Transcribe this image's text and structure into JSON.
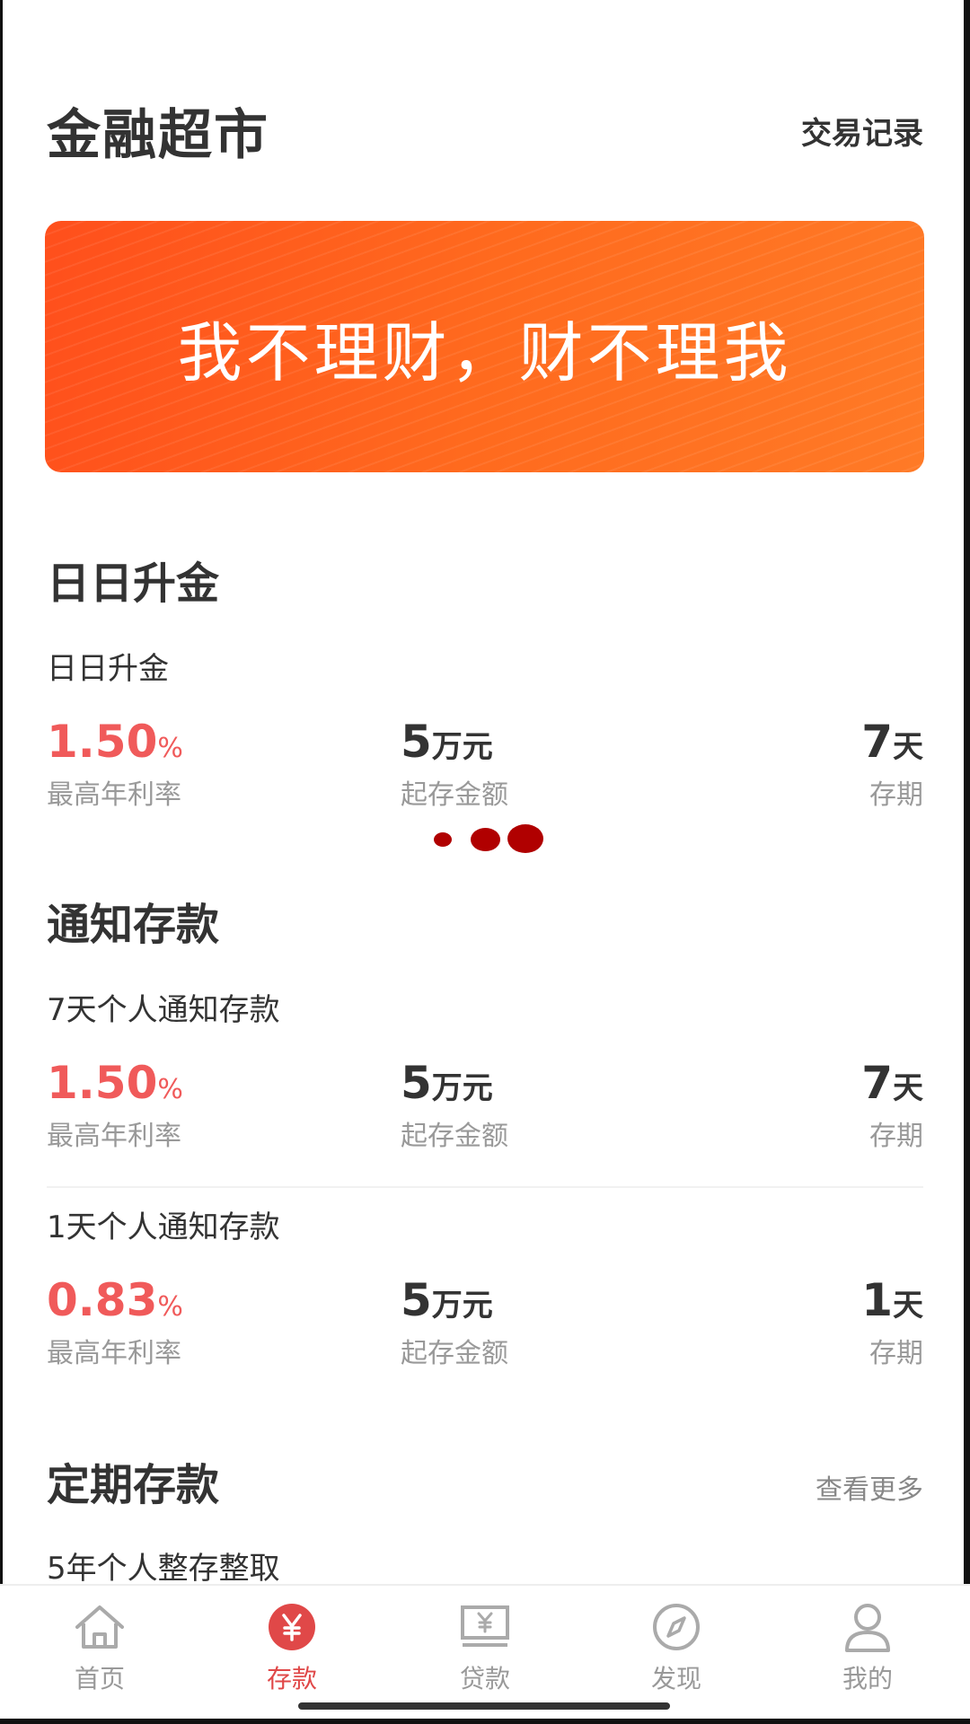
{
  "header": {
    "title": "金融超市",
    "link": "交易记录"
  },
  "banner": {
    "text": "我不理财，财不理我"
  },
  "sections": {
    "daily": {
      "title": "日日升金",
      "products": [
        {
          "name": "日日升金",
          "rate": "1.50",
          "rate_unit": "%",
          "rate_label": "最高年利率",
          "amount": "5",
          "amount_unit": "万元",
          "amount_label": "起存金额",
          "term": "7",
          "term_unit": "天",
          "term_label": "存期"
        }
      ]
    },
    "notice": {
      "title": "通知存款",
      "products": [
        {
          "name": "7天个人通知存款",
          "rate": "1.50",
          "rate_unit": "%",
          "rate_label": "最高年利率",
          "amount": "5",
          "amount_unit": "万元",
          "amount_label": "起存金额",
          "term": "7",
          "term_unit": "天",
          "term_label": "存期"
        },
        {
          "name": "1天个人通知存款",
          "rate": "0.83",
          "rate_unit": "%",
          "rate_label": "最高年利率",
          "amount": "5",
          "amount_unit": "万元",
          "amount_label": "起存金额",
          "term": "1",
          "term_unit": "天",
          "term_label": "存期"
        }
      ]
    },
    "fixed": {
      "title": "定期存款",
      "more": "查看更多",
      "products": [
        {
          "name": "5年个人整存整取"
        }
      ]
    }
  },
  "tabbar": {
    "items": [
      {
        "label": "首页",
        "icon": "home-icon"
      },
      {
        "label": "存款",
        "icon": "yuan-icon"
      },
      {
        "label": "贷款",
        "icon": "loan-icon"
      },
      {
        "label": "发现",
        "icon": "compass-icon"
      },
      {
        "label": "我的",
        "icon": "user-icon"
      }
    ],
    "active_index": 1
  },
  "colors": {
    "accent": "#f05a5a",
    "banner_start": "#ff4f1c",
    "banner_end": "#ff7a26",
    "loader": "#b00000"
  }
}
